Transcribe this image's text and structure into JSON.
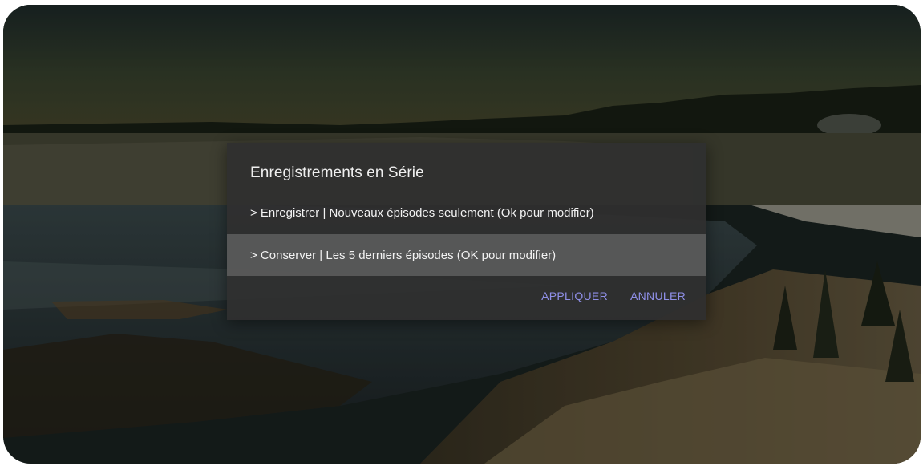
{
  "dialog": {
    "title": "Enregistrements en Série",
    "options": [
      {
        "label": "> Enregistrer | Nouveaux épisodes seulement (Ok pour modifier)"
      },
      {
        "label": "> Conserver | Les 5 derniers épisodes (OK pour modifier)",
        "selected": true
      }
    ],
    "apply_label": "APPLIQUER",
    "cancel_label": "ANNULER"
  },
  "colors": {
    "dialog_bg": "#2f2f2f",
    "selected_row_bg": "#5a5a5a",
    "action_text": "#8f8fe8",
    "text": "#f2f2f2"
  }
}
